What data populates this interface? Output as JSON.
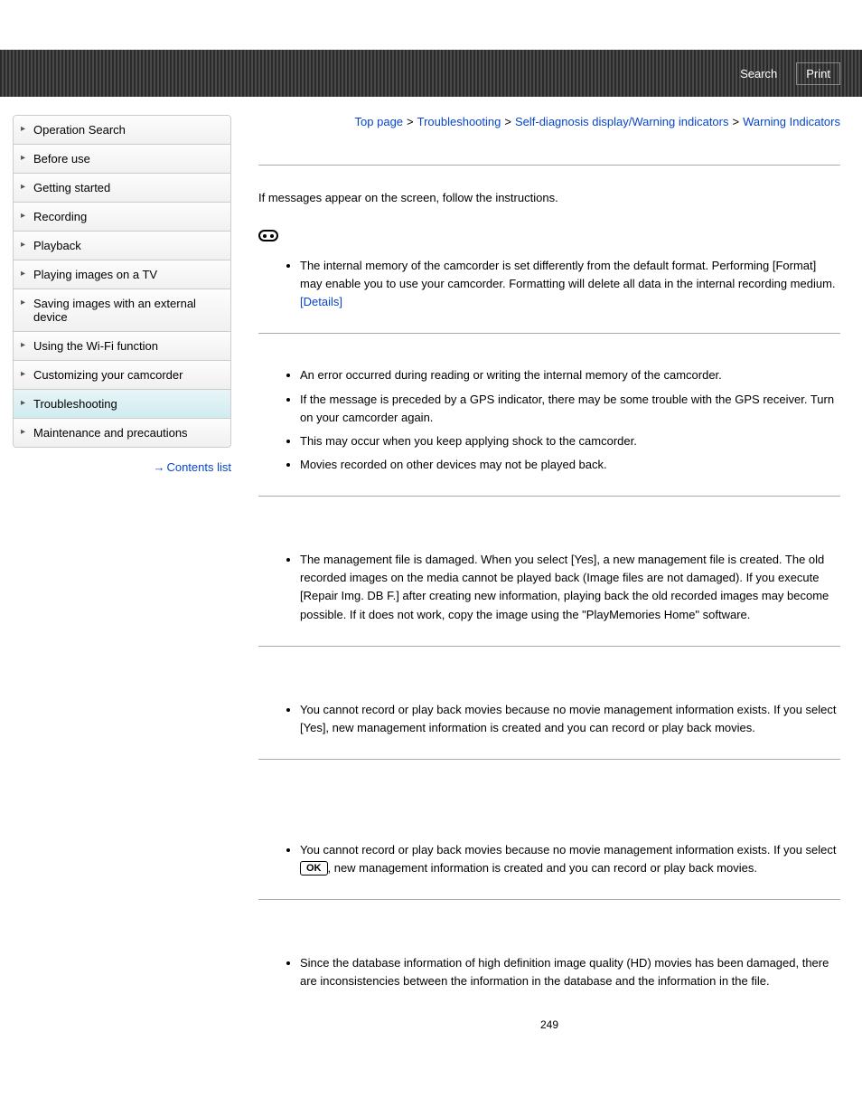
{
  "header": {
    "search": "Search",
    "print": "Print"
  },
  "sidebar": {
    "items": [
      "Operation Search",
      "Before use",
      "Getting started",
      "Recording",
      "Playback",
      "Playing images on a TV",
      "Saving images with an external device",
      "Using the Wi-Fi function",
      "Customizing your camcorder",
      "Troubleshooting",
      "Maintenance and precautions"
    ],
    "active_index": 9,
    "contents_list": "Contents list"
  },
  "breadcrumb": {
    "top": "Top page",
    "l1": "Troubleshooting",
    "l2": "Self-diagnosis display/Warning indicators",
    "current": "Warning Indicators"
  },
  "intro": "If messages appear on the screen, follow the instructions.",
  "sections": {
    "s1": {
      "item1_a": "The internal memory of the camcorder is set differently from the default format. Performing [Format] may enable you to use your camcorder. Formatting will delete all data in the internal recording medium. ",
      "details": "[Details]"
    },
    "s2": {
      "i1": "An error occurred during reading or writing the internal memory of the camcorder.",
      "i2": "If the message is preceded by a GPS indicator, there may be some trouble with the GPS receiver. Turn on your camcorder again.",
      "i3": "This may occur when you keep applying shock to the camcorder.",
      "i4": "Movies recorded on other devices may not be played back."
    },
    "s3": {
      "i1": "The management file is damaged. When you select [Yes], a new management file is created. The old recorded images on the media cannot be played back (Image files are not damaged). If you execute [Repair Img. DB F.] after creating new information, playing back the old recorded images may become possible. If it does not work, copy the image using the \"PlayMemories Home\" software."
    },
    "s4": {
      "i1": "You cannot record or play back movies because no movie management information exists. If you select [Yes], new management information is created and you can record or play back movies."
    },
    "s5": {
      "i1_a": "You cannot record or play back movies because no movie management information exists. If you select ",
      "ok": "OK",
      "i1_b": ", new management information is created and you can record or play back movies."
    },
    "s6": {
      "i1": "Since the database information of high definition image quality (HD) movies has been damaged, there are inconsistencies between the information in the database and the information in the file."
    }
  },
  "page_number": "249"
}
